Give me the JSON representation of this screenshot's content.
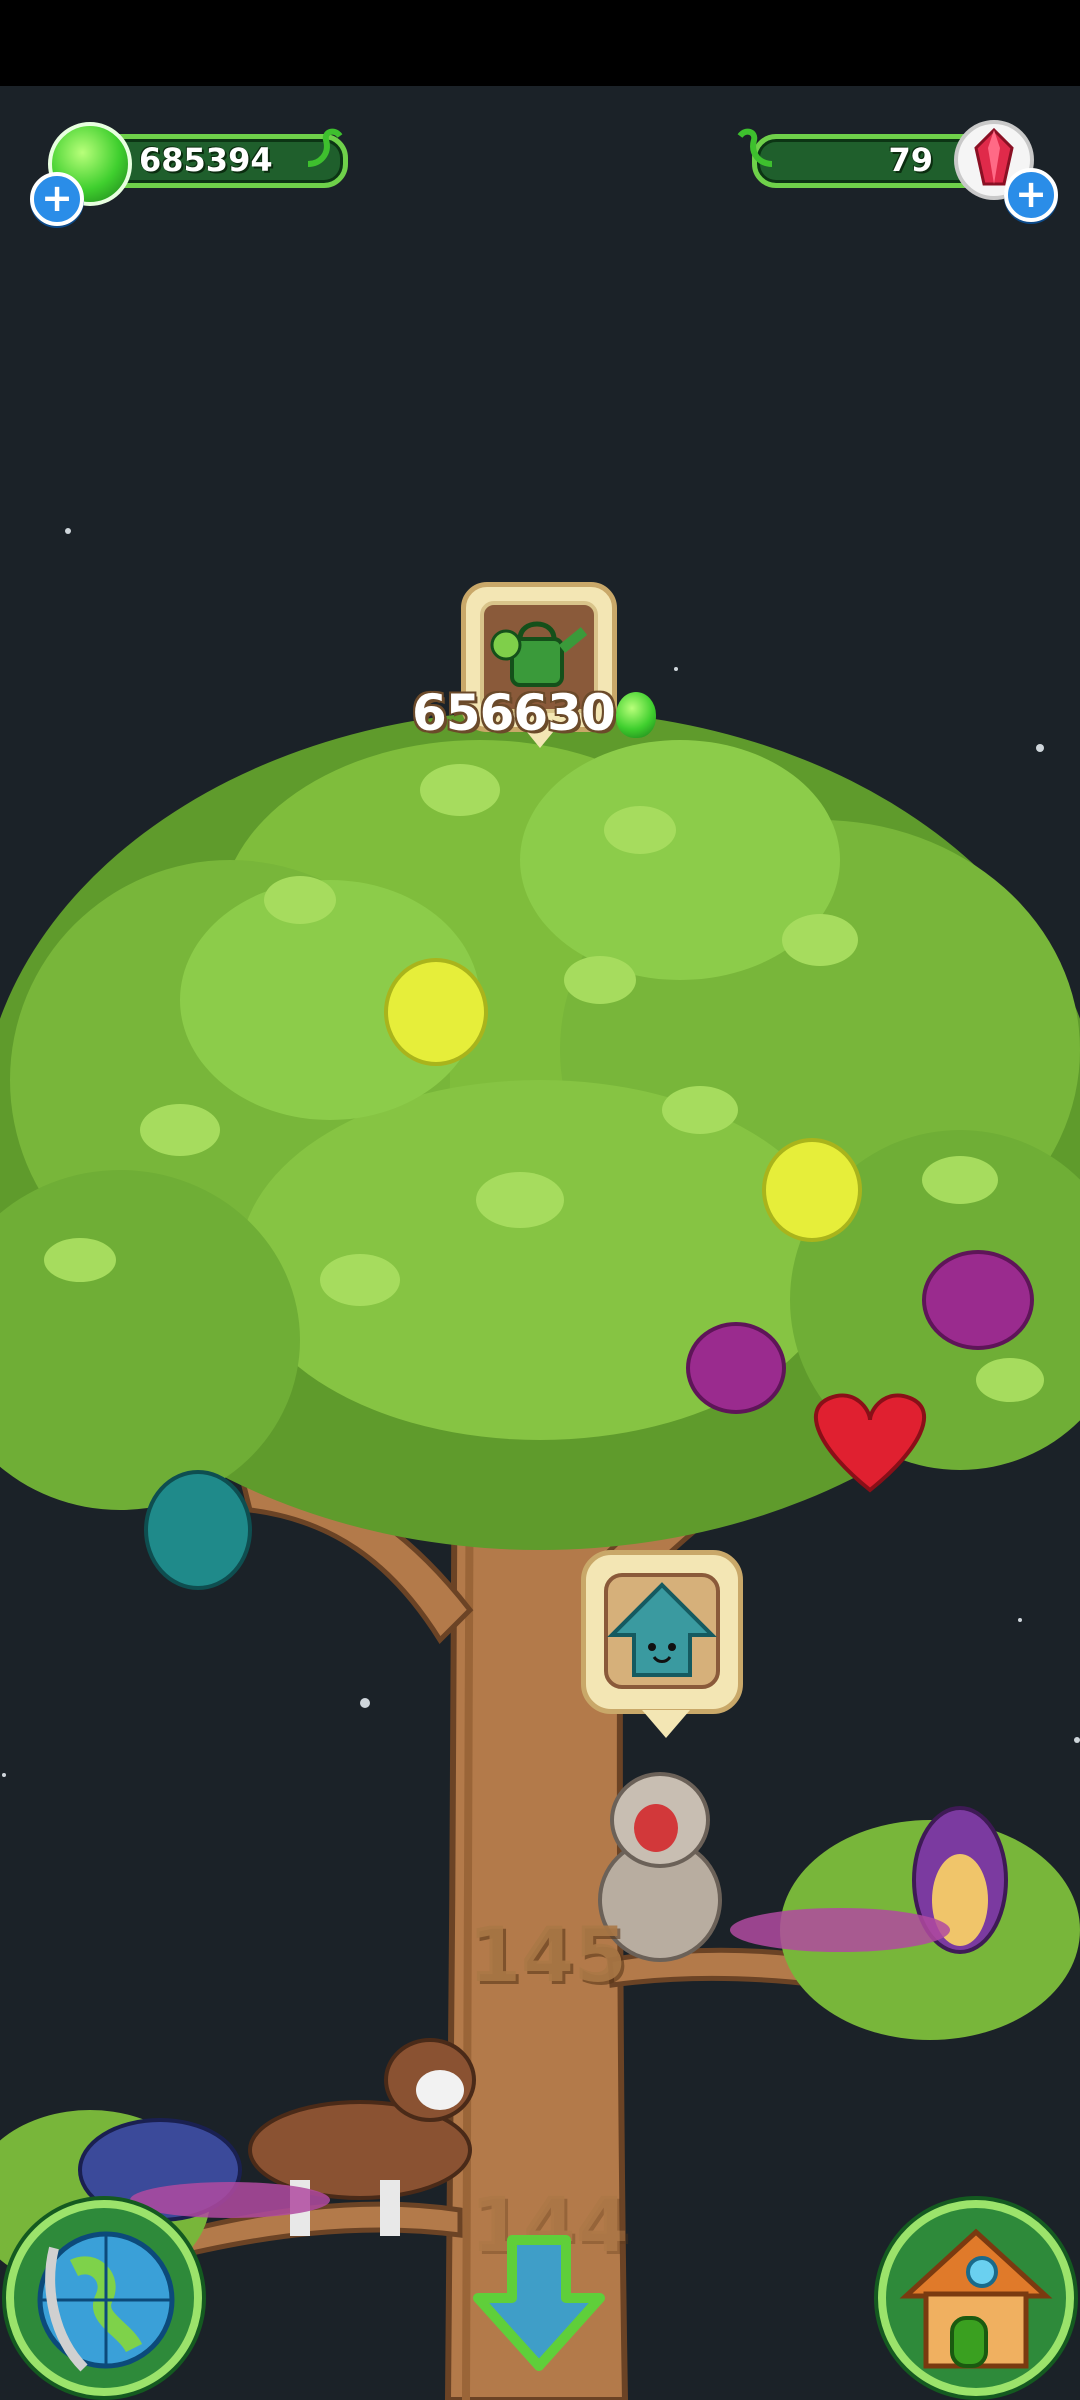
{
  "currency": {
    "drops_value": "685394",
    "crystals_value": "79",
    "drops_icon": "green-drop-icon",
    "crystals_icon": "red-crystal-icon",
    "add_icon": "plus-icon"
  },
  "tree": {
    "water_cost": "656630",
    "water_icon": "watering-can-icon",
    "cost_currency_icon": "green-drop-icon",
    "upgrade_icon": "house-up-arrow-icon",
    "level_current": "145",
    "level_below": "144"
  },
  "nav": {
    "map_icon": "globe-icon",
    "home_icon": "treehouse-icon",
    "down_icon": "down-arrow-icon"
  },
  "colors": {
    "background": "#1b2228",
    "bar_fill": "#1f5f2c",
    "bar_border": "#6fd14a",
    "leaf": "#8ccc4a",
    "trunk": "#b37a4a"
  }
}
